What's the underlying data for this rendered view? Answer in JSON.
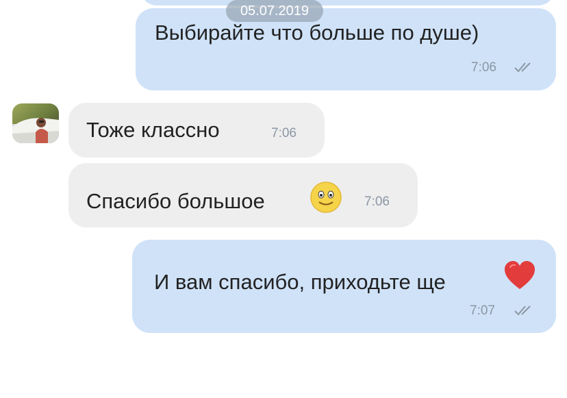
{
  "chat": {
    "date_separator": "05.07.2019",
    "messages": [
      {
        "direction": "outgoing",
        "text": "Выбирайте что больше по душе)",
        "time": "7:06",
        "status": "read"
      },
      {
        "direction": "incoming",
        "text": "Тоже классно",
        "time": "7:06"
      },
      {
        "direction": "incoming",
        "text": "Спасибо большое",
        "emoji": "slightly-smiling-face",
        "time": "7:06"
      },
      {
        "direction": "outgoing",
        "text": "И вам спасибо, приходьте ще",
        "emoji": "red-heart",
        "time": "7:07",
        "status": "read"
      }
    ]
  },
  "colors": {
    "outgoing_bubble": "#cfe2f8",
    "incoming_bubble": "#eeeeef",
    "date_pill": "#96a5b4",
    "time_text": "#8b96a3"
  }
}
